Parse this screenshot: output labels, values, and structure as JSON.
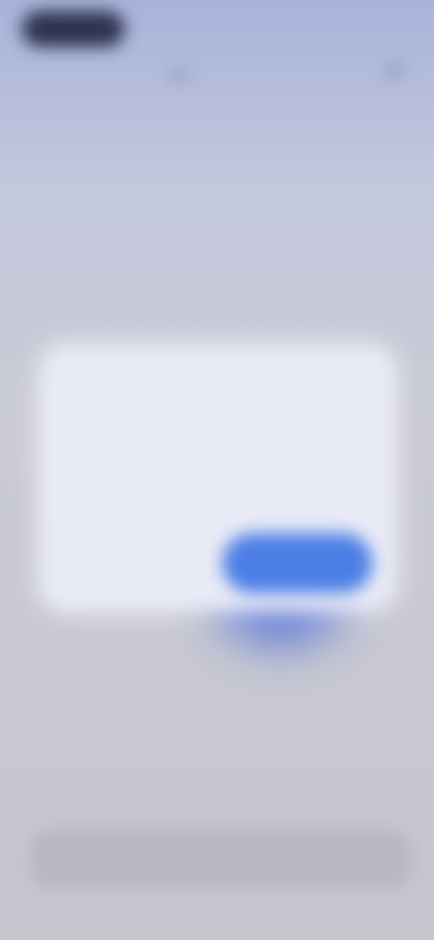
{
  "status_bar": {
    "indicator": "status-pill"
  },
  "header": {
    "headline": "",
    "subline": ""
  },
  "dialog": {
    "title": "",
    "body": "",
    "cancel_label": "",
    "confirm_label": ""
  },
  "bottom": {
    "label": ""
  },
  "colors": {
    "accent": "#4c7fe6",
    "glow": "#3f61d6",
    "background_top": "#a9b3da",
    "background_bottom": "#c6c6cf",
    "card": "#e8eaf6"
  }
}
